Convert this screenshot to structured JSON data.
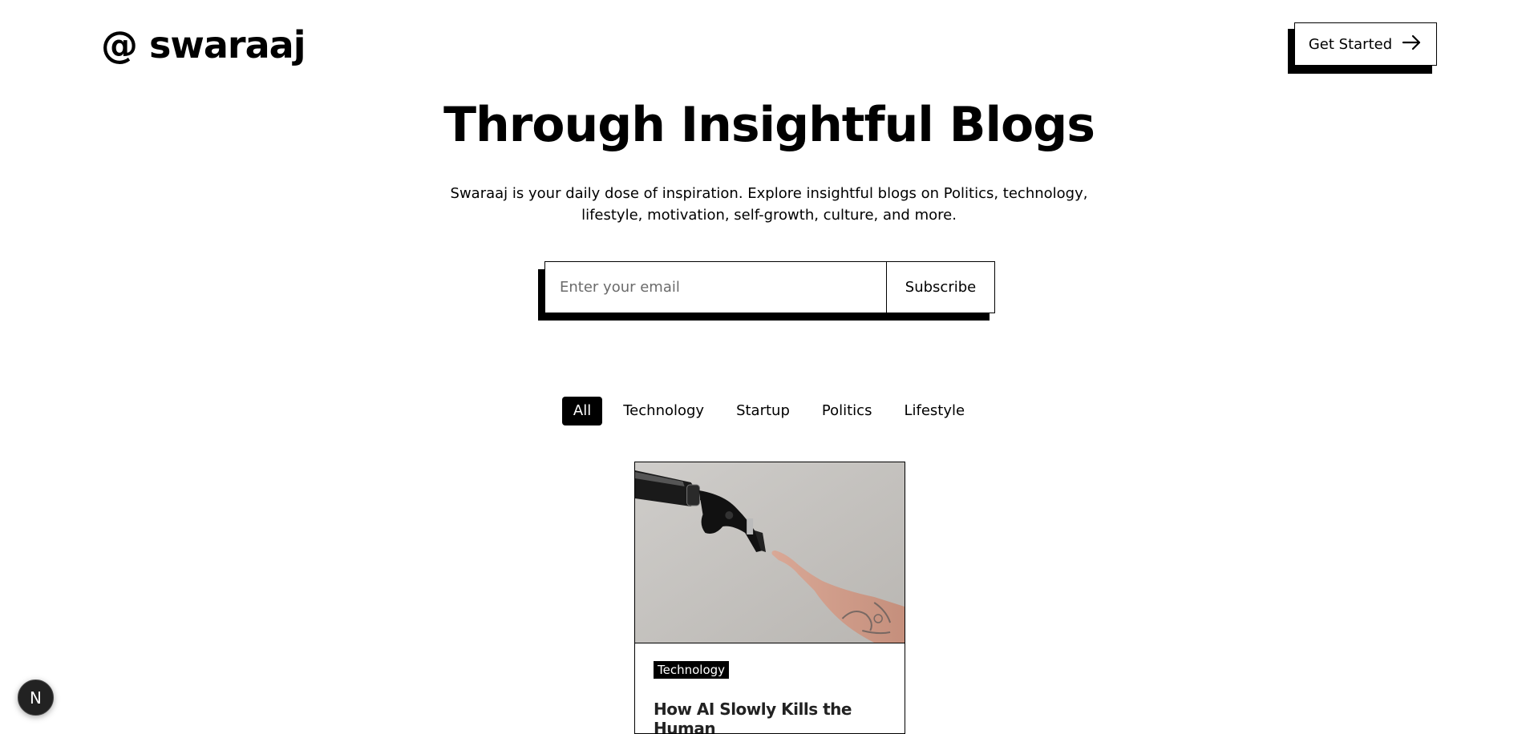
{
  "header": {
    "logo_text": "@ swaraaj",
    "cta_label": "Get Started",
    "cta_icon": "arrow-right-icon"
  },
  "hero": {
    "title": "Through Insightful Blogs",
    "description": "Swaraaj is your daily dose of inspiration. Explore insightful blogs on Politics, technology, lifestyle, motivation, self-growth, culture, and more."
  },
  "subscribe": {
    "placeholder": "Enter your email",
    "value": "",
    "button_label": "Subscribe"
  },
  "filters": {
    "items": [
      "All",
      "Technology",
      "Startup",
      "Politics",
      "Lifestyle"
    ],
    "active": "All"
  },
  "posts": [
    {
      "category": "Technology",
      "title": "How AI Slowly Kills the Human",
      "image_icon": "robot-hand-touching-human-hand-image"
    }
  ],
  "dev_badge": {
    "letter": "N",
    "icon": "nextjs-icon"
  },
  "colors": {
    "background": "#ffffff",
    "text": "#000000",
    "accent": "#000000"
  }
}
